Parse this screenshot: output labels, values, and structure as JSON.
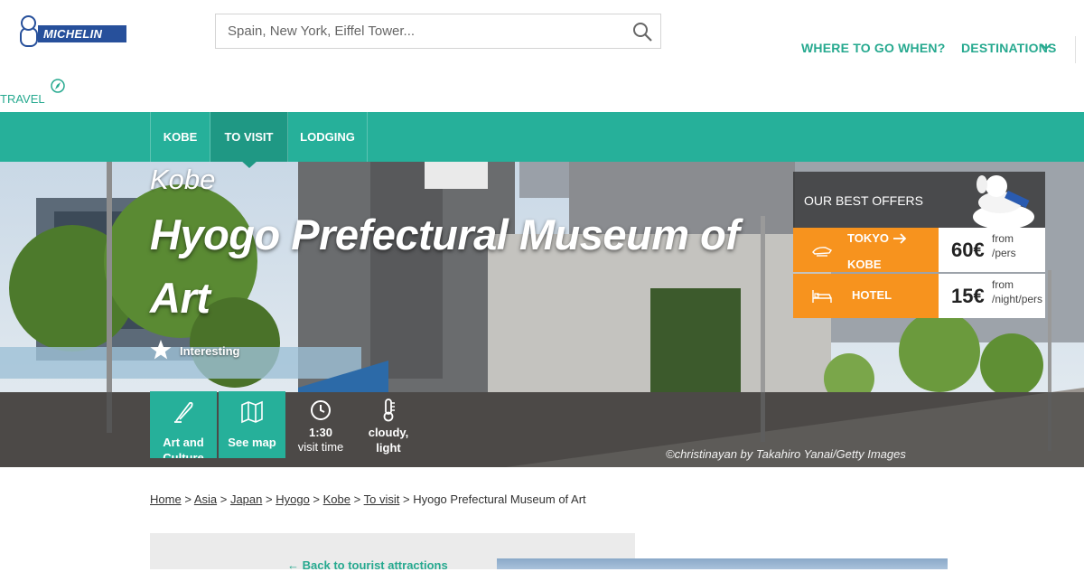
{
  "header": {
    "brand": "MICHELIN",
    "travel_label": "TRAVEL",
    "search_placeholder": "Spain, New York, Eiffel Tower...",
    "nav": {
      "where_to_go": "WHERE TO GO WHEN?",
      "destinations": "DESTINATIONS"
    }
  },
  "tabs": [
    {
      "label": "KOBE",
      "active": false
    },
    {
      "label": "TO VISIT",
      "active": true
    },
    {
      "label": "LODGING",
      "active": false
    }
  ],
  "hero": {
    "city": "Kobe",
    "title": "Hyogo Prefectural Museum of Art",
    "rating_label": "Interesting",
    "actions": [
      {
        "label": "Art and Culture",
        "icon": "quill-icon"
      },
      {
        "label": "See map",
        "icon": "map-icon"
      }
    ],
    "visit_time": {
      "value": "1:30",
      "label": "visit time",
      "icon": "clock-icon"
    },
    "weather": {
      "value": "cloudy,",
      "label": "light",
      "icon": "thermometer-icon"
    },
    "credit": "©christinayan by Takahiro Yanai/Getty Images"
  },
  "offers": {
    "title": "OUR BEST OFFERS",
    "transport": {
      "from_city": "TOKYO",
      "to_city": "KOBE",
      "price": "60€",
      "from_label": "from",
      "unit": "/pers"
    },
    "hotel": {
      "label": "HOTEL",
      "price": "15€",
      "from_label": "from",
      "unit": "/night/pers"
    }
  },
  "breadcrumb": {
    "items": [
      "Home",
      "Asia",
      "Japan",
      "Hyogo",
      "Kobe",
      "To visit"
    ],
    "sep": ">",
    "current": "Hyogo Prefectural Museum of Art"
  },
  "content": {
    "back_link": "Back to tourist attractions"
  },
  "colors": {
    "teal": "#26b09a",
    "teal_dark": "#1f9884",
    "orange": "#f7931e",
    "michelin_blue": "#27509b"
  }
}
